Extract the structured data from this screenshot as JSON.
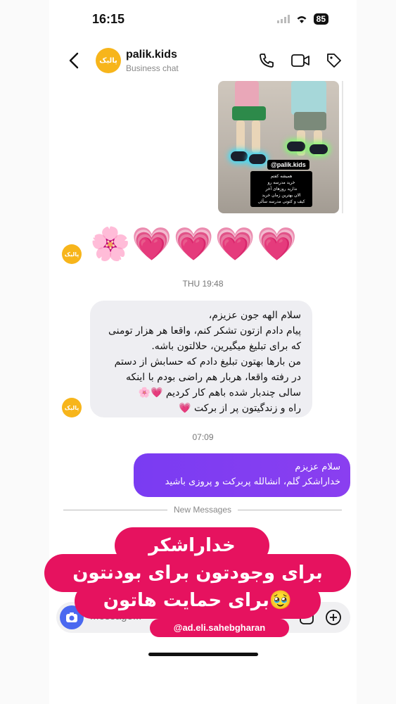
{
  "status_bar": {
    "time": "16:15",
    "battery": "85"
  },
  "header": {
    "name": "palik.kids",
    "subtitle": "Business chat",
    "avatar_text": "پالیک"
  },
  "photo": {
    "tag": "@palik.kids",
    "caption_lines": [
      "همیشه کفتم",
      "خرید مدرسه رو",
      "نذارید روزهای آخر",
      "الان بهترین زمان خرید",
      "کیف و کتونی مدرسه سآلی"
    ]
  },
  "emoji_row": "🌸💗💗💗💗",
  "timestamps": {
    "first": "THU 19:48",
    "second": "07:09"
  },
  "incoming_message": {
    "lines": [
      "سلام الهه جون عزیزم،",
      "پیام دادم ازتون تشکر کنم، واقعا هر هزار تومنی",
      "که برای تبلیغ میگیرین، حلالتون باشه.",
      "من بارها بهتون تبلیغ دادم که حسابش از دستم",
      "در رفته واقعا، هربار هم راضی بودم با اینکه",
      "سالی چندبار شده باهم کار کردیم 💗🌸",
      "راه و زندگیتون پر از برکت 💗"
    ]
  },
  "outgoing_message": {
    "lines": [
      "سلام عزیزم",
      "خداراشکر گلم، انشالله پربرکت و پروزی باشید"
    ]
  },
  "divider_label": "New Messages",
  "composer": {
    "placeholder": "Message..."
  },
  "overlay": {
    "line1": "خداراشکر",
    "line2": "برای وجودتون برای بودنتون",
    "line3": "برای حمایت هاتون🥹",
    "watermark": "@ad.eli.sahebgharan"
  },
  "colors": {
    "accent_purple": "#7c3aed",
    "overlay_pink": "#e6125f",
    "avatar_orange": "#f7b51b"
  }
}
